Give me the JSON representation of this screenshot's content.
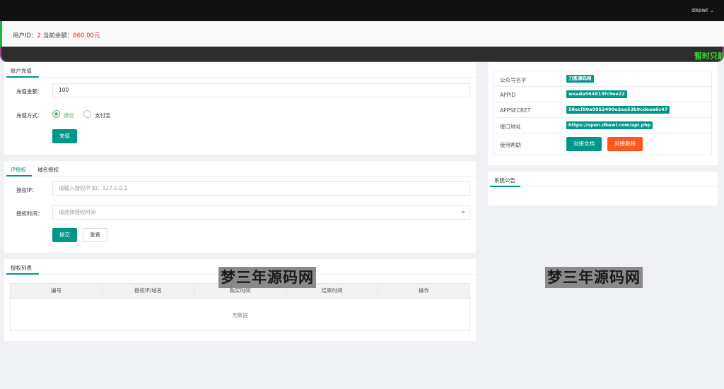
{
  "header": {
    "username": "dkewl"
  },
  "notice": {
    "user_id_label": "用户ID：",
    "user_id": "2",
    "balance_label": "当前余额：",
    "balance": "860.00元"
  },
  "marquee": {
    "text": "暂时只能"
  },
  "recharge": {
    "tab": "账户充值",
    "amount_label": "充值金额：",
    "amount_value": "100",
    "method_label": "充值方式：",
    "methods": [
      "微信",
      "支付宝"
    ],
    "submit": "充值"
  },
  "auth": {
    "tabs": [
      "IP授权",
      "域名授权"
    ],
    "ip_label": "授权IP：",
    "ip_placeholder": "请输入授权IP 如：127.0.0.1",
    "time_label": "授权时间：",
    "time_placeholder": "请选择授权时间",
    "submit": "提交",
    "reset": "重置"
  },
  "auth_list": {
    "tab": "授权列表",
    "columns": [
      "编号",
      "授权IP/域名",
      "购买时间",
      "结束时间",
      "操作"
    ],
    "empty_text": "无数据"
  },
  "api_info": {
    "rows": [
      {
        "key": "公众号名字",
        "value": "刀客源码网"
      },
      {
        "key": "APPID",
        "value": "wxada564813fc9ee22"
      },
      {
        "key": "APPSECRET",
        "value": "58ecf80a9952490e2ea53b9cdeea6c47"
      },
      {
        "key": "接口地址",
        "value": "https://open.dkewl.com/api.php"
      }
    ],
    "help_label": "使用帮助",
    "doc_button": "对接文档",
    "tutorial_button": "对接教程"
  },
  "announcement": {
    "tab": "系统公告"
  },
  "watermarks": [
    "梦三年源码网",
    "梦三年源码网"
  ],
  "colors": {
    "accent": "#009688",
    "orange": "#ff5722",
    "topbar": "#111111",
    "marquee": "#2fe02f"
  }
}
